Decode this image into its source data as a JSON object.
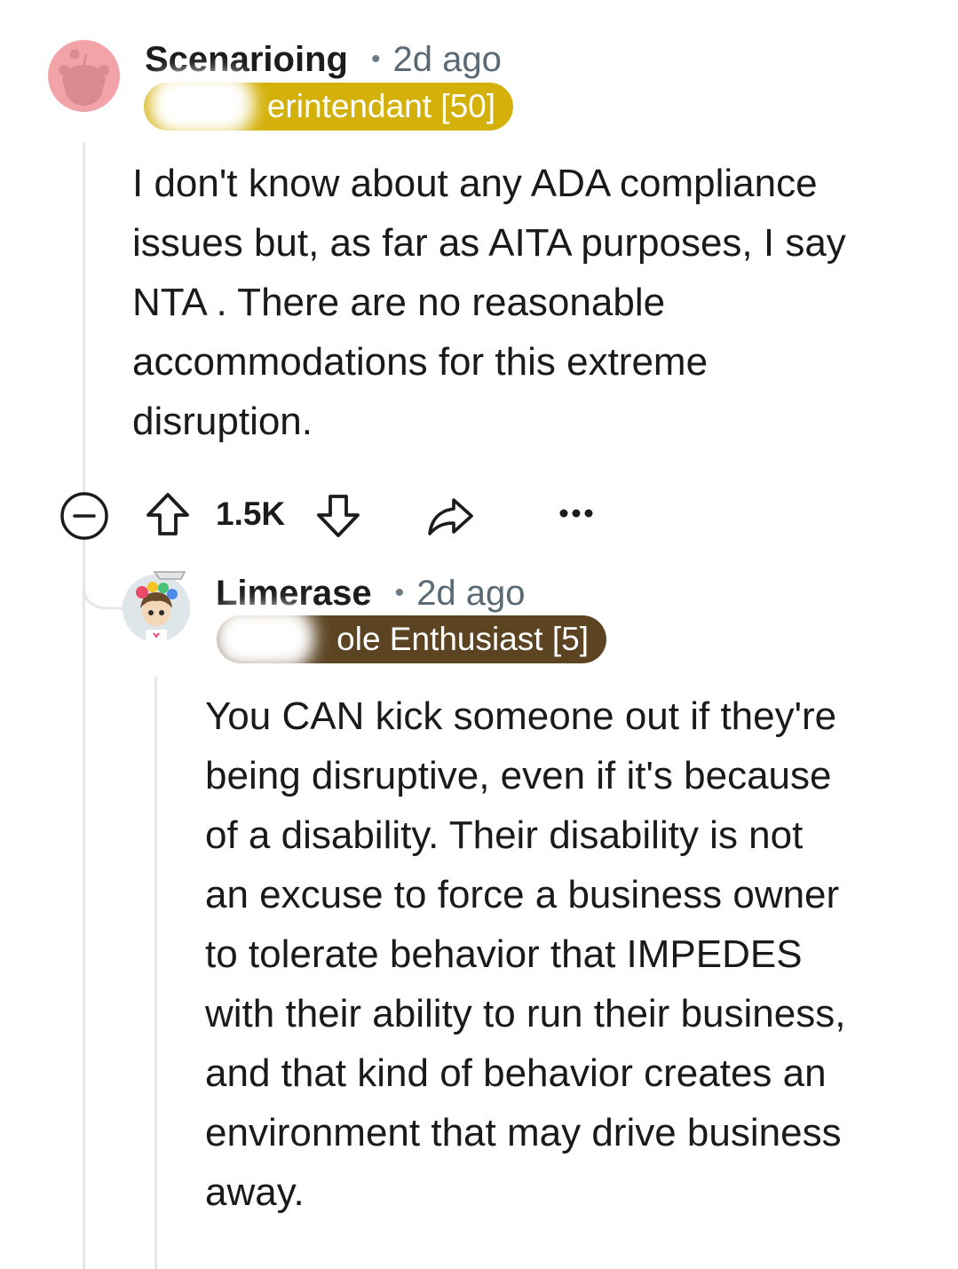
{
  "comments": [
    {
      "username": "Scenarioing",
      "separator": "•",
      "time": "2d ago",
      "flair": "erintendant [50]",
      "flair_color": "#d4b10a",
      "lines": [
        "I don't know about any ADA compliance",
        "issues but, as far as AITA purposes, I say",
        "NTA . There are no reasonable",
        "accommodations for this extreme",
        "disruption."
      ]
    },
    {
      "username": "Limerase",
      "separator": "•",
      "time": "2d ago",
      "flair": "ole Enthusiast [5]",
      "flair_color": "#5c4423",
      "lines": [
        "You CAN kick someone out if they're",
        "being disruptive, even if it's because",
        "of a disability. Their disability is not",
        "an excuse to force a business owner",
        "to tolerate behavior that IMPEDES",
        "with their ability to run their business,",
        "and that kind of behavior creates an",
        "environment that may drive business",
        "away."
      ]
    }
  ],
  "actions": {
    "score": "1.5K",
    "icons": [
      "collapse-icon",
      "upvote-icon",
      "downvote-icon",
      "share-icon",
      "more-options-icon"
    ]
  },
  "colors": {
    "accent_avatar_1": "#f2a3a8",
    "thread_line": "#e5e7e9",
    "meta_text": "#5a6a75"
  }
}
